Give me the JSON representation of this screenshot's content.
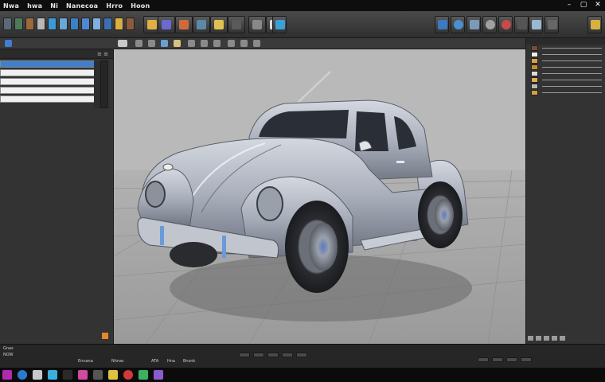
{
  "menu": {
    "items": [
      "Nwa",
      "hwa",
      "Ni",
      "Nanecoa",
      "Hrro",
      "Hoon"
    ]
  },
  "window_controls": {
    "minimize": "–",
    "maximize": "▢",
    "close": "✕"
  },
  "left_panel": {
    "rows": [
      "",
      "",
      "",
      "",
      ""
    ]
  },
  "timeline": {
    "labels": [
      "Gnas",
      "NOW",
      "Ennana",
      "Nhnac",
      "ATA",
      "Hna",
      "Bnsnk"
    ]
  },
  "colors": {
    "accent_blue": "#3f7fd0",
    "accent_orange": "#e0882a",
    "car_body": "#a9aebb",
    "viewport_bg": "#b9b9b9"
  },
  "icons": {
    "toolbar": [
      "cube-icon",
      "sphere-icon",
      "light-icon",
      "camera-icon",
      "material-icon",
      "render-icon"
    ],
    "taskbar": [
      "start-icon",
      "browser-icon",
      "folder-icon",
      "mail-icon",
      "media-icon",
      "app-icon"
    ]
  }
}
